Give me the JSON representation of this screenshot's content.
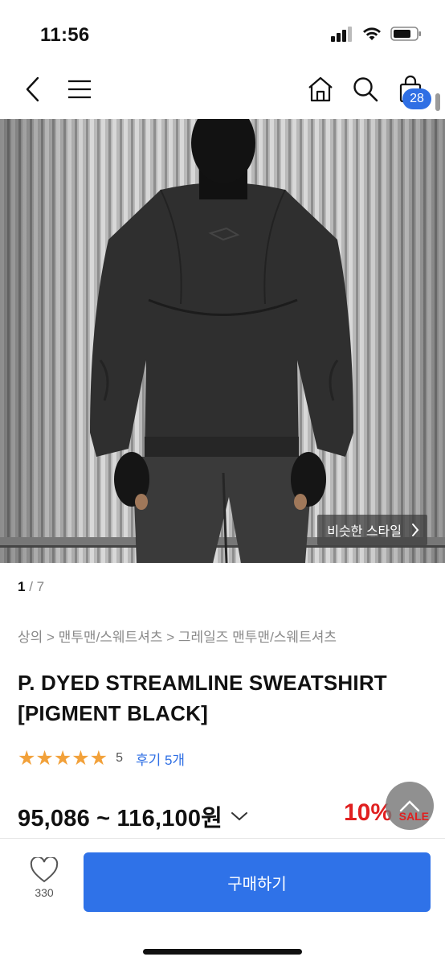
{
  "status": {
    "time": "11:56"
  },
  "nav": {
    "cart_count": "28"
  },
  "hero": {
    "similar_style_label": "비슷한 스타일"
  },
  "pager": {
    "current": "1",
    "separator": "/",
    "total": "7"
  },
  "breadcrumb": "상의 > 맨투맨/스웨트셔츠 > 그레일즈 맨투맨/스웨트셔츠",
  "product": {
    "title": "P. DYED STREAMLINE SWEATSHIRT [PIGMENT BLACK]",
    "stars": "★★★★★",
    "rating": "5",
    "reviews_label": "후기 5개",
    "price_range": "95,086 ~ 116,100원",
    "discount": "10%",
    "sale_label": "SALE"
  },
  "bottom": {
    "like_count": "330",
    "buy_label": "구매하기"
  },
  "colors": {
    "accent": "#2f72e8",
    "star": "#f2a13a",
    "discount": "#e02020"
  }
}
